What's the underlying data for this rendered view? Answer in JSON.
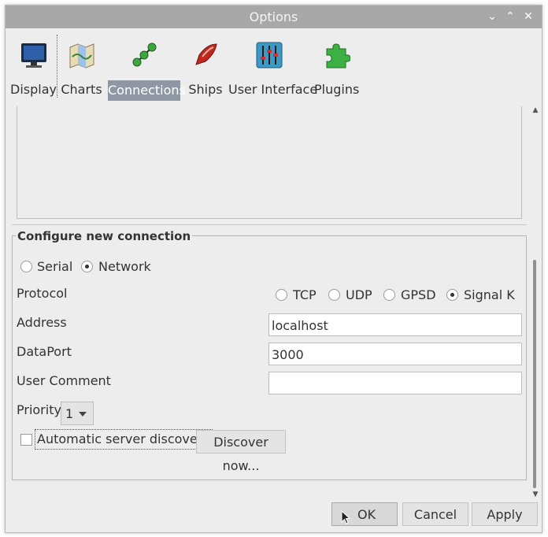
{
  "window": {
    "title": "Options",
    "controls": [
      "minimize-icon",
      "maximize-icon",
      "close-icon"
    ]
  },
  "toolbar": {
    "items": [
      {
        "label": "Display",
        "icon": "monitor-icon"
      },
      {
        "label": "Charts",
        "icon": "charts-icon"
      },
      {
        "label": "Connections",
        "icon": "connections-icon",
        "selected": true
      },
      {
        "label": "Ships",
        "icon": "ship-icon"
      },
      {
        "label": "User Interface",
        "icon": "sliders-icon"
      },
      {
        "label": "Plugins",
        "icon": "puzzle-icon"
      }
    ]
  },
  "connection": {
    "group_title": "Configure new connection",
    "type_options": [
      "Serial",
      "Network"
    ],
    "type_selected": "Network",
    "protocol_label": "Protocol",
    "protocol_options": [
      "TCP",
      "UDP",
      "GPSD",
      "Signal K"
    ],
    "protocol_selected": "Signal K",
    "address_label": "Address",
    "address_value": "localhost",
    "dataport_label": "DataPort",
    "dataport_value": "3000",
    "comment_label": "User Comment",
    "comment_value": "",
    "priority_label": "Priority",
    "priority_value": "1",
    "auto_discovery_label": "Automatic server discovery",
    "auto_discovery_checked": false,
    "discover_button": "Discover now..."
  },
  "buttons": {
    "ok": "OK",
    "cancel": "Cancel",
    "apply": "Apply"
  },
  "colors": {
    "titlebar": "#a8a8a8",
    "selected_tab": "#8e97a3",
    "background": "#ededed"
  }
}
